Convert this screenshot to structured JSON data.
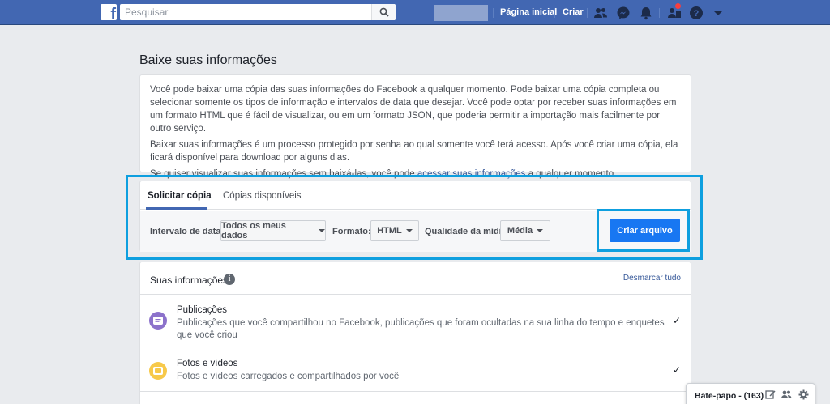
{
  "topbar": {
    "logo": "f",
    "search_placeholder": "Pesquisar",
    "home": "Página inicial",
    "create": "Criar",
    "icons": [
      "friends-icon",
      "messenger-icon",
      "bell-icon",
      "people-icon",
      "help-icon",
      "caret-down-icon"
    ]
  },
  "page": {
    "title": "Baixe suas informações"
  },
  "info": {
    "p1": "Você pode baixar uma cópia das suas informações do Facebook a qualquer momento. Pode baixar uma cópia completa ou selecionar somente os tipos de informação e intervalos de data que desejar. Você pode optar por receber suas informações em um formato HTML que é fácil de visualizar, ou em um formato JSON, que poderia permitir a importação mais facilmente por outro serviço.",
    "p2": "Baixar suas informações é um processo protegido por senha ao qual somente você terá acesso. Após você criar uma cópia, ela ficará disponível para download por alguns dias.",
    "p3_before": "Se quiser visualizar suas informações sem baixá-las, você pode ",
    "p3_link": "acessar suas informações",
    "p3_after": " a qualquer momento."
  },
  "request": {
    "tab_active": "Solicitar cópia",
    "tab_inactive": "Cópias disponíveis",
    "date_label": "Intervalo de datas:",
    "date_value": "Todos os meus dados",
    "format_label": "Formato:",
    "format_value": "HTML",
    "quality_label": "Qualidade da mídia:",
    "quality_value": "Média",
    "create_button": "Criar arquivo"
  },
  "yours": {
    "title": "Suas informações",
    "unmark": "Desmarcar tudo",
    "items": [
      {
        "title": "Publicações",
        "desc": "Publicações que você compartilhou no Facebook, publicações que foram ocultadas na sua linha do tempo e enquetes que você criou",
        "icon": "post-icon",
        "color": "#8c72cb"
      },
      {
        "title": "Fotos e vídeos",
        "desc": "Fotos e vídeos carregados e compartilhados por você",
        "icon": "photo-icon",
        "color": "#f7c94a"
      }
    ]
  },
  "chat": {
    "label": "Bate-papo - (163)"
  },
  "colors": {
    "brand": "#4267b2",
    "button": "#1877f2",
    "highlight": "#0e9fdf"
  }
}
